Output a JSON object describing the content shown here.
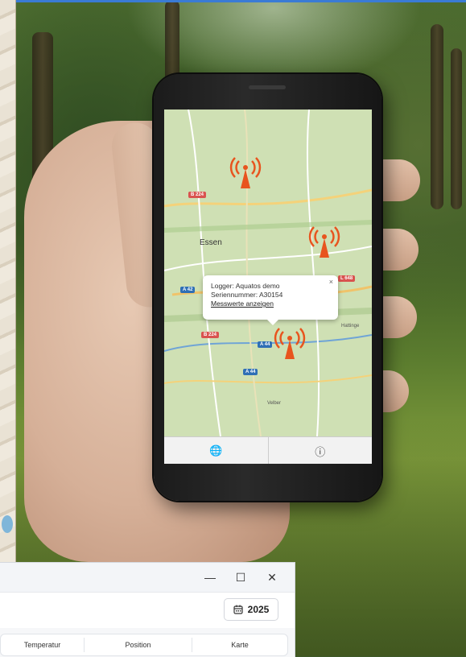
{
  "map": {
    "city": "Essen",
    "roads": {
      "b224_top": "B 224",
      "l648": "L 648",
      "a42": "A 42",
      "b224_mid": "B 224",
      "a44_a": "A 44",
      "a44_b": "A 44"
    },
    "places": {
      "hattingen": "Hattinge",
      "velbert": "Velber"
    }
  },
  "popup": {
    "logger_line": "Logger: Aquatos demo",
    "serial_line": "Seriennummer: A30154",
    "link": "Messwerte anzeigen",
    "close": "×"
  },
  "phone_nav": {
    "globe_icon": "🌐",
    "info_icon": "ⓘ"
  },
  "window": {
    "minimize": "—",
    "maximize": "☐",
    "close": "✕",
    "year": "2025",
    "columns": [
      "Temperatur",
      "Position",
      "Karte"
    ]
  },
  "colors": {
    "marker": "#e8541e",
    "accent": "#3a7bd5"
  }
}
